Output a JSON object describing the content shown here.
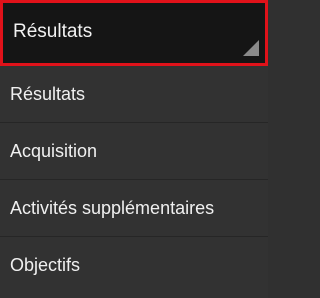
{
  "spinner": {
    "selected_label": "Résultats"
  },
  "menu": {
    "items": [
      {
        "label": "Résultats"
      },
      {
        "label": "Acquisition"
      },
      {
        "label": "Activités supplémentaires"
      },
      {
        "label": "Objectifs"
      }
    ]
  },
  "colors": {
    "highlight_border": "#e0121a",
    "background": "#303030",
    "spinner_background": "#151515",
    "text": "#f0f0f0"
  }
}
